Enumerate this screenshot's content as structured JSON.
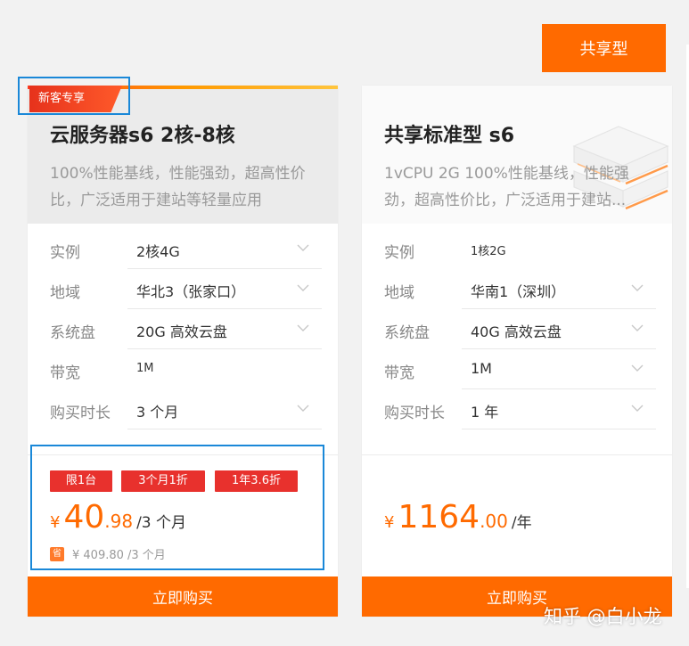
{
  "top_button": {
    "label": "共享型"
  },
  "cards": [
    {
      "badge": "新客专享",
      "title": "云服务器s6 2核-8核",
      "description": "100%性能基线，性能强劲，超高性价比，广泛适用于建站等轻量应用",
      "rows": [
        {
          "label": "实例",
          "value": "2核4G"
        },
        {
          "label": "地域",
          "value": "华北3（张家口）"
        },
        {
          "label": "系统盘",
          "value": "20G 高效云盘"
        },
        {
          "label": "带宽",
          "value": "1M"
        },
        {
          "label": "购买时长",
          "value": "3 个月"
        }
      ],
      "tags": [
        "限1台",
        "3个月1折",
        "1年3.6折"
      ],
      "price": {
        "currency": "¥",
        "integer": "40",
        "decimal": ".98",
        "unit": "/3 个月"
      },
      "original_price": {
        "icon": "省",
        "text": "¥ 409.80 /3 个月"
      },
      "buy_label": "立即购买"
    },
    {
      "title": "共享标准型 s6",
      "description": "1vCPU 2G 100%性能基线，性能强劲，超高性价比，广泛适用于建站...",
      "rows": [
        {
          "label": "实例",
          "value": "1核2G"
        },
        {
          "label": "地域",
          "value": "华南1（深圳）"
        },
        {
          "label": "系统盘",
          "value": "40G 高效云盘"
        },
        {
          "label": "带宽",
          "value": "1M"
        },
        {
          "label": "购买时长",
          "value": "1 年"
        }
      ],
      "price": {
        "currency": "¥",
        "integer": "1164",
        "decimal": ".00",
        "unit": "/年"
      },
      "buy_label": "立即购买"
    }
  ],
  "watermark": "知乎 @白小龙",
  "colors": {
    "accent": "#ff6a00",
    "tag_red": "#e8312d",
    "highlight_frame": "#1a88d8"
  }
}
